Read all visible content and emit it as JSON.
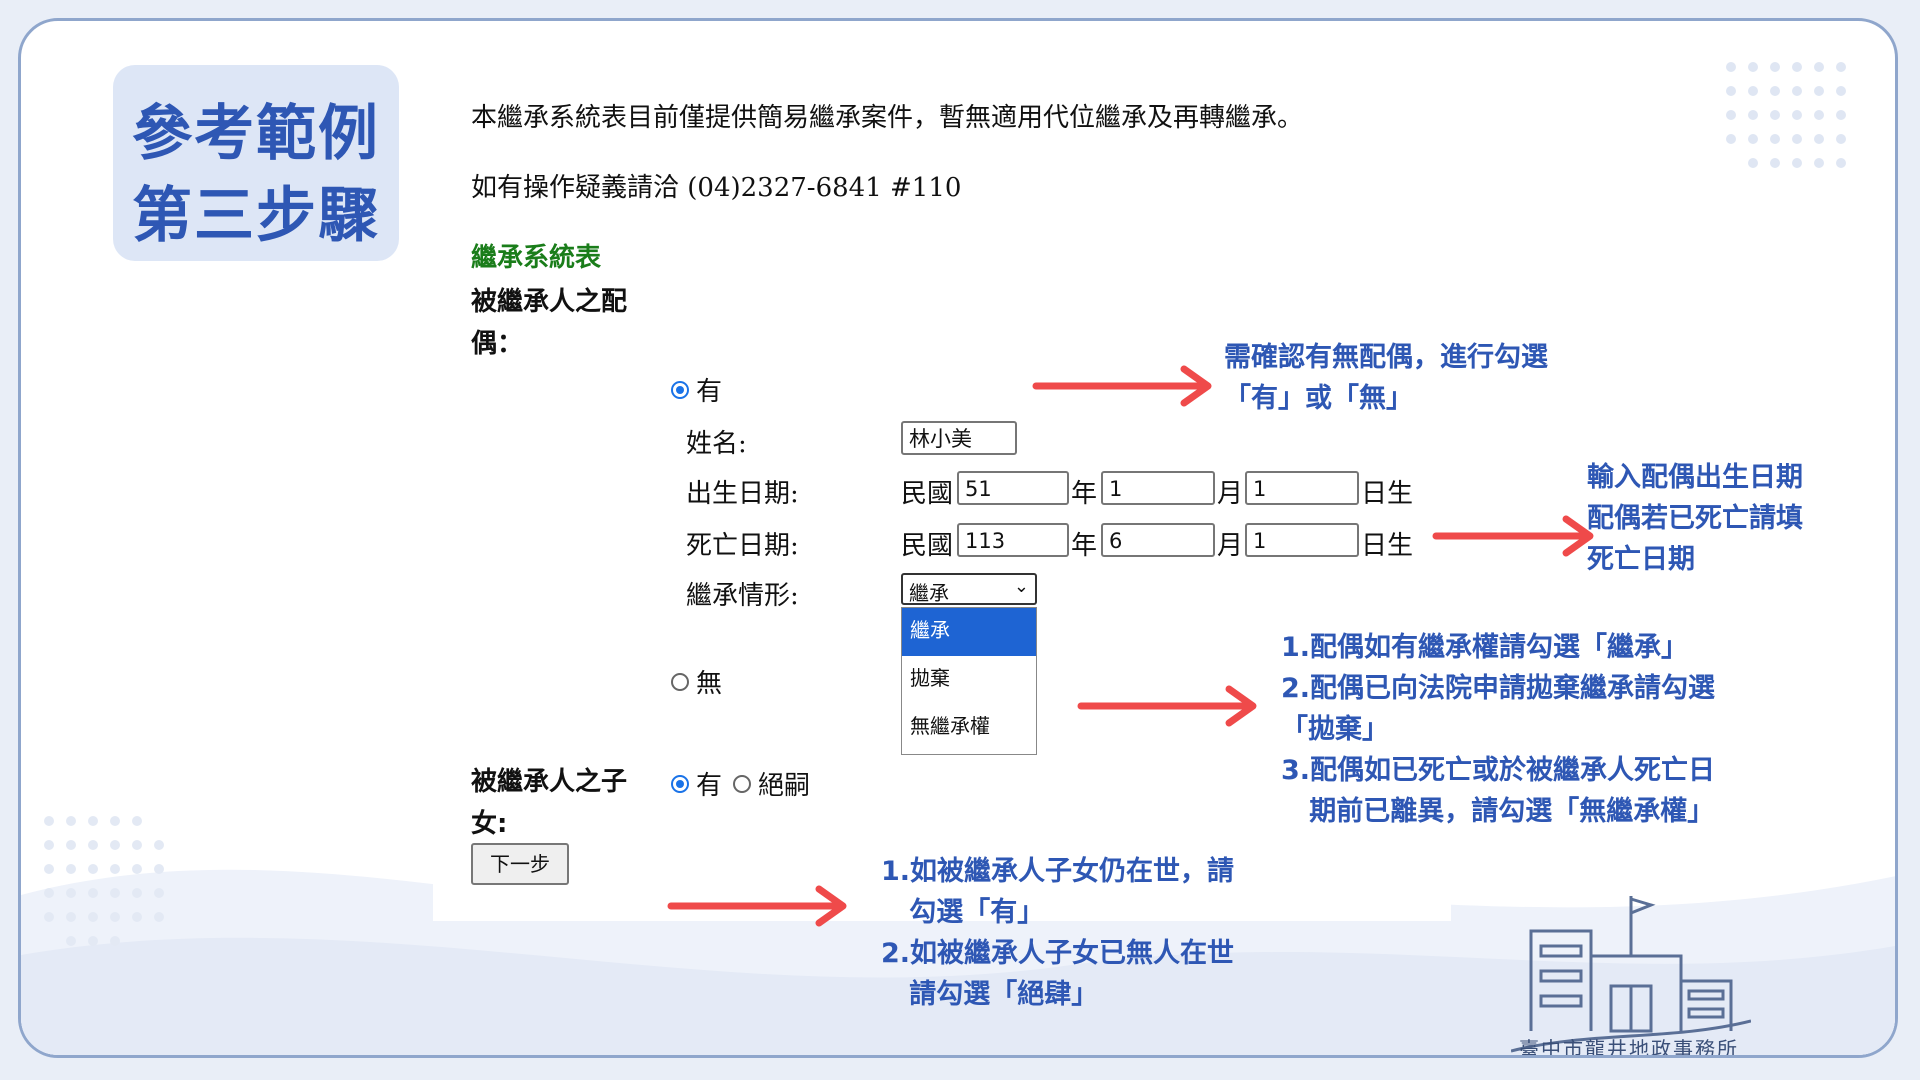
{
  "slide": {
    "title_line1": "參考範例",
    "title_line2": "第三步驟",
    "org_name": "臺中市龍井地政事務所"
  },
  "form": {
    "intro_text": "本繼承系統表目前僅提供簡易繼承案件，暫無適用代位繼承及再轉繼承。",
    "contact_text": "如有操作疑義請洽 (04)2327-6841 #110",
    "section_heading": "繼承系統表",
    "spouse_label_line1": "被繼承人之配",
    "spouse_label_line2": "偶：",
    "spouse_yes": "有",
    "spouse_no": "無",
    "name_label": "姓名:",
    "name_value": "林小美",
    "birth_label": "出生日期:",
    "death_label": "死亡日期:",
    "inherit_label": "繼承情形:",
    "era": "民國",
    "year_unit": "年",
    "month_unit": "月",
    "day_unit": "日生",
    "birth_year": "51",
    "birth_month": "1",
    "birth_day": "1",
    "death_year": "113",
    "death_month": "6",
    "death_day": "1",
    "inherit_selected": "繼承",
    "inherit_options": [
      "繼承",
      "拋棄",
      "無繼承權"
    ],
    "children_label_line1": "被繼承人之子",
    "children_label_line2": "女:",
    "children_yes": "有",
    "children_none": "絕嗣",
    "next_button": "下一步"
  },
  "notes": {
    "spouse_check": [
      "需確認有無配偶，進行勾選",
      "「有」或「無」"
    ],
    "birth_death": [
      "輸入配偶出生日期",
      "配偶若已死亡請填",
      "死亡日期"
    ],
    "inherit": [
      "1.配偶如有繼承權請勾選「繼承」",
      "2.配偶已向法院申請拋棄繼承請勾選",
      "「拋棄」",
      "3.配偶如已死亡或於被繼承人死亡日",
      "   期前已離異，請勾選「無繼承權」"
    ],
    "children": [
      "1.如被繼承人子女仍在世，請",
      "   勾選「有」",
      "2.如被繼承人子女已無人在世",
      "   請勾選「絕肆」"
    ]
  },
  "colors": {
    "accent_blue": "#2e57b4",
    "arrow_red": "#ef4a4a",
    "heading_green": "#1a7d1a",
    "radio_blue": "#1a73e8"
  }
}
